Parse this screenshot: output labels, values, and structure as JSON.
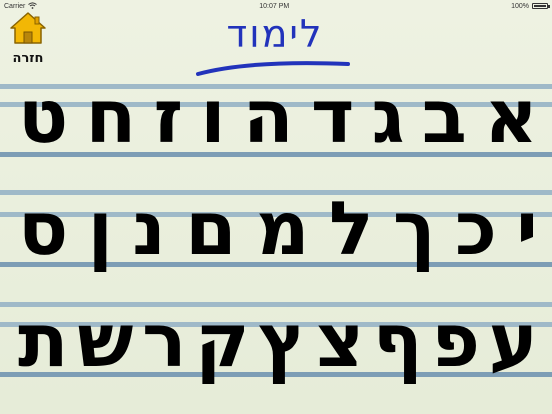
{
  "status_bar": {
    "carrier": "Carrier",
    "time": "10:07 PM",
    "battery_text": "100%",
    "battery_level": 1.0,
    "wifi_icon": "wifi-icon"
  },
  "home": {
    "label": "חזרה",
    "icon": "house-icon",
    "color": "#f2b705"
  },
  "title": {
    "text": "לימוד",
    "color": "#2233bb"
  },
  "rows": [
    [
      "א",
      "ב",
      "ג",
      "ד",
      "ה",
      "ו",
      "ז",
      "ח",
      "ט"
    ],
    [
      "י",
      "כ",
      "ך",
      "ל",
      "מ",
      "ם",
      "נ",
      "ן",
      "ס"
    ],
    [
      "ע",
      "פ",
      "ף",
      "צ",
      "ץ",
      "ק",
      "ר",
      "ש",
      "ת"
    ]
  ],
  "colors": {
    "background": "#e9eedb",
    "rule": "#9fb9c8"
  }
}
